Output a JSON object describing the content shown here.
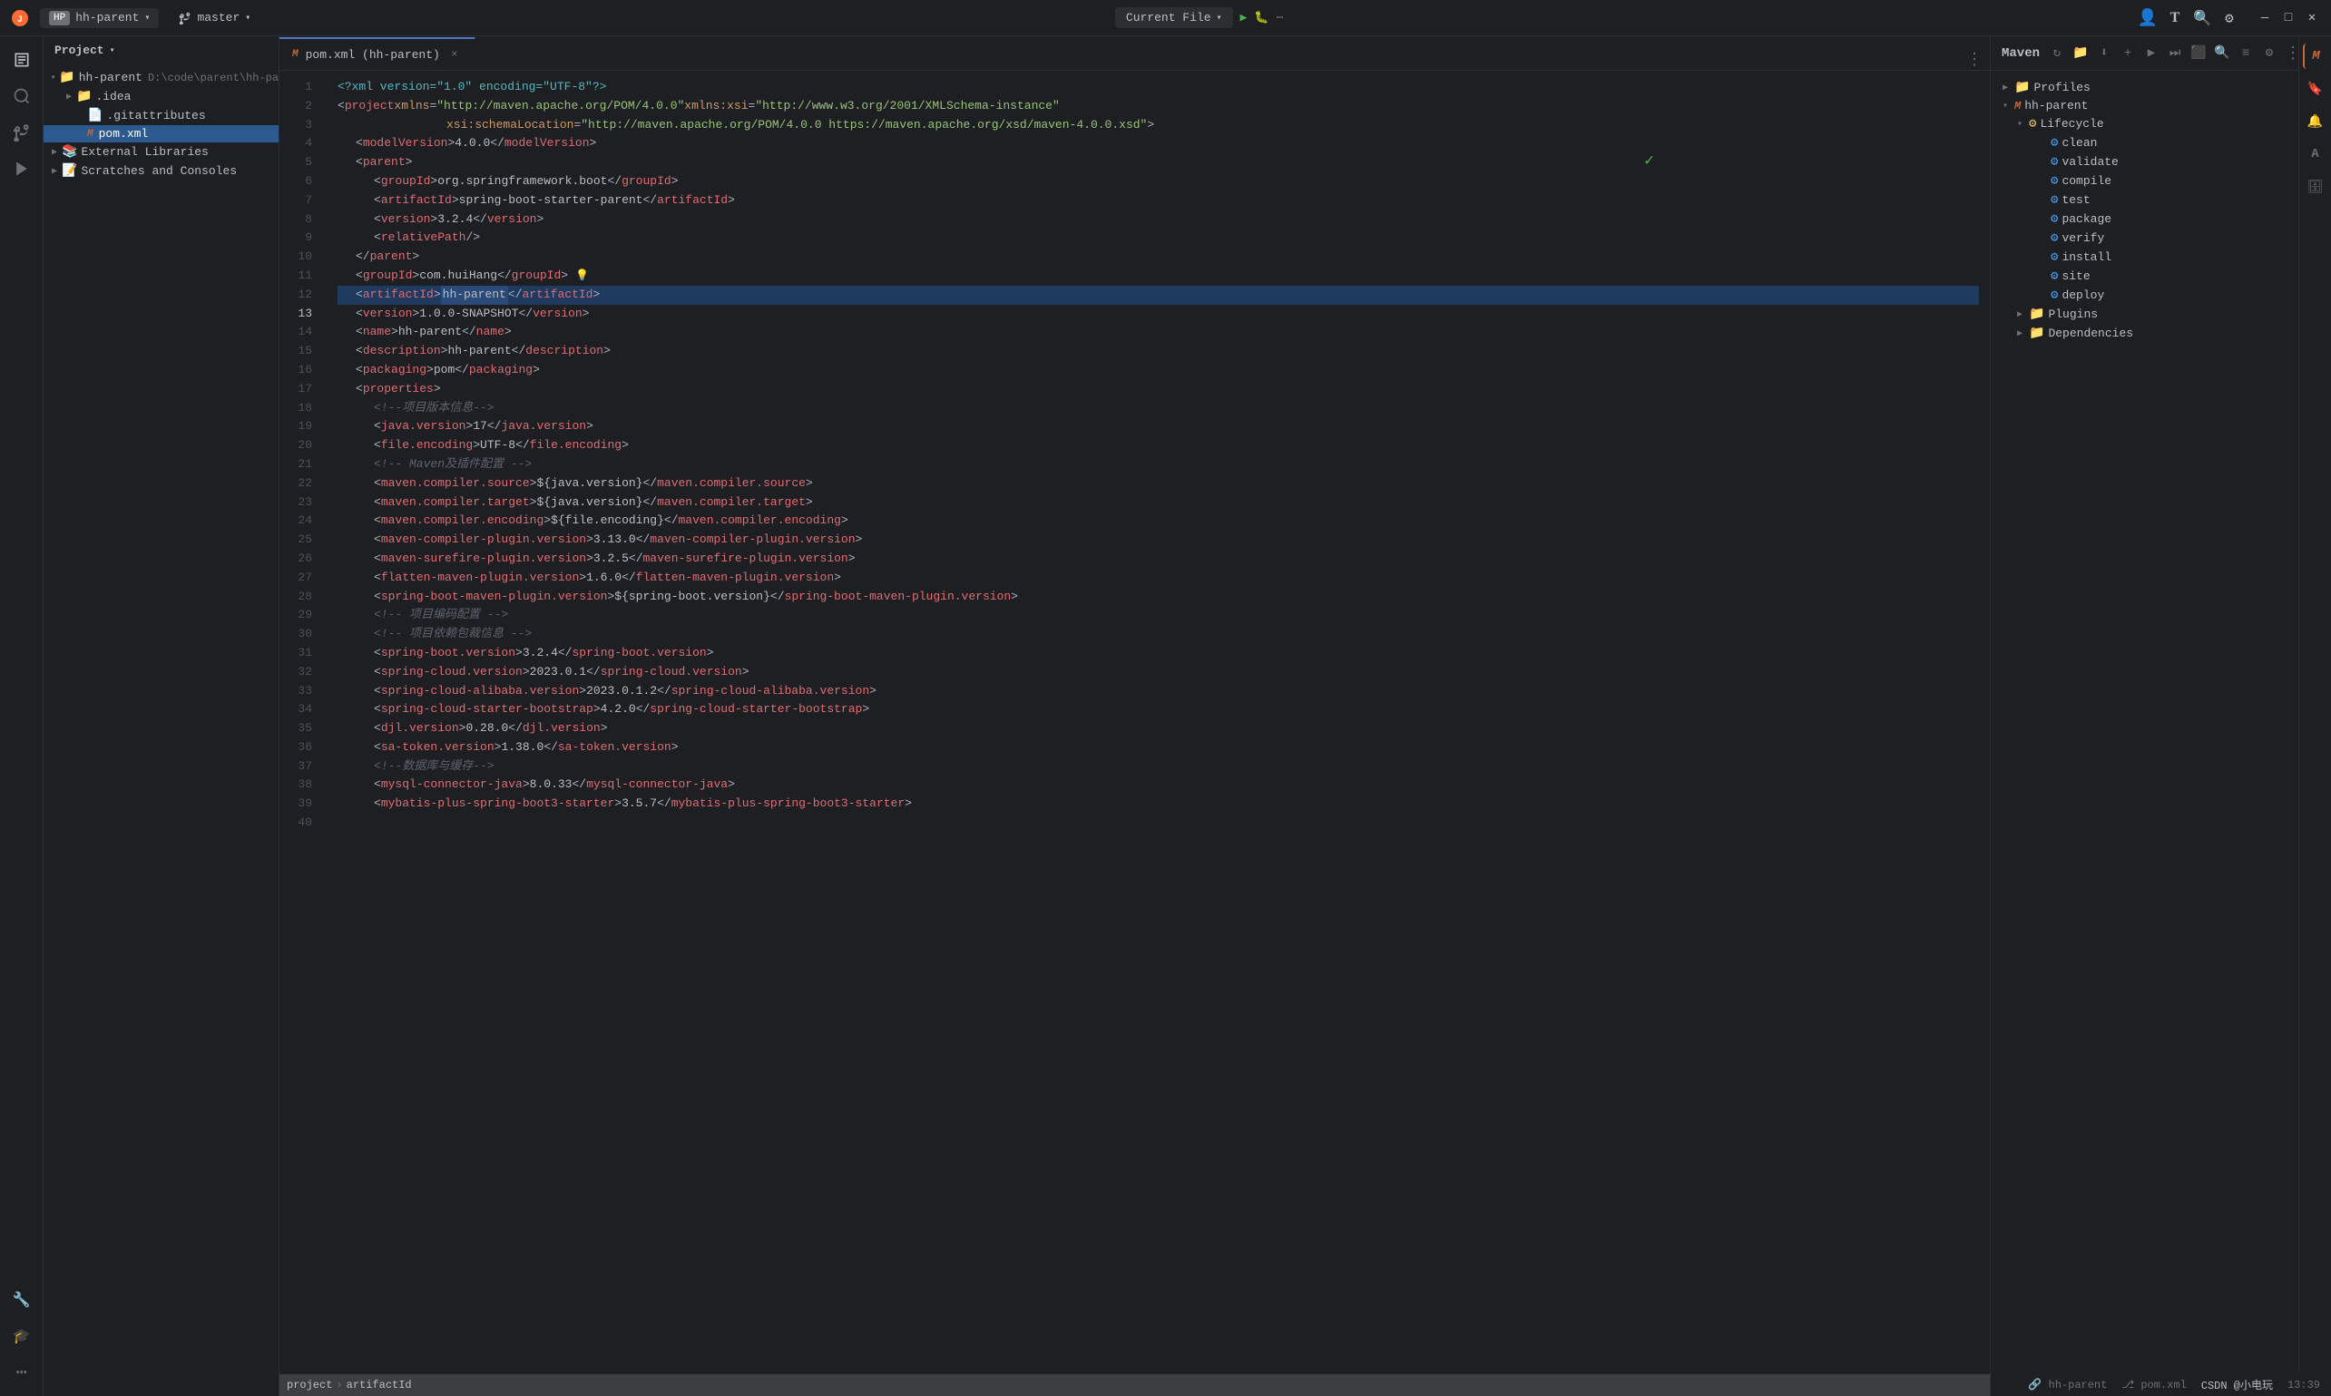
{
  "titleBar": {
    "logo": "🟠",
    "projectLabel": "hh-parent",
    "projectDropdown": "▾",
    "branchIcon": "⎇",
    "branchLabel": "master",
    "branchDropdown": "▾",
    "currentFile": "Current File",
    "currentFileDropdown": "▾",
    "runIcon": "▶",
    "debugIcon": "🐛",
    "moreIcon": "⋯",
    "searchIcon": "🔍",
    "settingsIcon": "⚙",
    "userIcon": "👤",
    "translateIcon": "T",
    "minimizeIcon": "—",
    "maximizeIcon": "□",
    "closeIcon": "✕"
  },
  "activityBar": {
    "icons": [
      {
        "name": "files-icon",
        "symbol": "📁",
        "active": true
      },
      {
        "name": "search-icon",
        "symbol": "🔍",
        "active": false
      },
      {
        "name": "git-icon",
        "symbol": "⎇",
        "active": false
      },
      {
        "name": "run-icon",
        "symbol": "▶",
        "active": false
      },
      {
        "name": "more-icon",
        "symbol": "⋯",
        "active": false
      }
    ]
  },
  "sidebar": {
    "title": "Project",
    "chevron": "▾",
    "tree": [
      {
        "id": 1,
        "level": 0,
        "chevron": "▾",
        "icon": "📁",
        "label": "hh-parent",
        "path": "D:\\code\\parent\\hh-pa",
        "selected": false,
        "type": "folder"
      },
      {
        "id": 2,
        "level": 1,
        "chevron": "▾",
        "icon": "📁",
        "label": ".idea",
        "path": "",
        "selected": false,
        "type": "folder"
      },
      {
        "id": 3,
        "level": 1,
        "chevron": " ",
        "icon": "📄",
        "label": ".gitattributes",
        "path": "",
        "selected": false,
        "type": "file"
      },
      {
        "id": 4,
        "level": 1,
        "chevron": " ",
        "icon": "M",
        "label": "pom.xml",
        "path": "",
        "selected": true,
        "type": "maven"
      },
      {
        "id": 5,
        "level": 0,
        "chevron": "▶",
        "icon": "📚",
        "label": "External Libraries",
        "path": "",
        "selected": false,
        "type": "folder"
      },
      {
        "id": 6,
        "level": 0,
        "chevron": "▶",
        "icon": "📝",
        "label": "Scratches and Consoles",
        "path": "",
        "selected": false,
        "type": "folder"
      }
    ]
  },
  "editor": {
    "tab": {
      "icon": "M",
      "label": "pom.xml (hh-parent)",
      "closeIcon": "×"
    },
    "lines": [
      {
        "num": 1,
        "content": "<?xml version=\"1.0\" encoding=\"UTF-8\"?>",
        "type": "pi"
      },
      {
        "num": 2,
        "content": "<project xmlns=\"http://maven.apache.org/POM/4.0.0\" xmlns:xsi=\"http://www.w3.org/2001/XMLSchema-instance\"",
        "type": "tag"
      },
      {
        "num": 3,
        "content": "         xsi:schemaLocation=\"http://maven.apache.org/POM/4.0.0 https://maven.apache.org/xsd/maven-4.0.0.xsd\">",
        "type": "tag"
      },
      {
        "num": 4,
        "content": "    <modelVersion>4.0.0</modelVersion>",
        "type": "tag"
      },
      {
        "num": 5,
        "content": "    <parent>",
        "type": "tag"
      },
      {
        "num": 6,
        "content": "        <groupId>org.springframework.boot</groupId>",
        "type": "tag"
      },
      {
        "num": 7,
        "content": "        <artifactId>spring-boot-starter-parent</artifactId>",
        "type": "tag"
      },
      {
        "num": 8,
        "content": "        <version>3.2.4</version>",
        "type": "tag"
      },
      {
        "num": 9,
        "content": "        <relativePath/>",
        "type": "tag"
      },
      {
        "num": 10,
        "content": "    </parent>",
        "type": "tag"
      },
      {
        "num": 11,
        "content": "",
        "type": "empty"
      },
      {
        "num": 12,
        "content": "    <groupId>com.huiHang</groupId>",
        "type": "tag",
        "hasHint": true
      },
      {
        "num": 13,
        "content": "    <artifactId>hh-parent</artifactId>",
        "type": "tag",
        "highlighted": true
      },
      {
        "num": 14,
        "content": "    <version>1.0.0-SNAPSHOT</version>",
        "type": "tag"
      },
      {
        "num": 15,
        "content": "    <name>hh-parent</name>",
        "type": "tag"
      },
      {
        "num": 16,
        "content": "    <description>hh-parent</description>",
        "type": "tag"
      },
      {
        "num": 17,
        "content": "    <packaging>pom</packaging>",
        "type": "tag"
      },
      {
        "num": 18,
        "content": "    <properties>",
        "type": "tag"
      },
      {
        "num": 19,
        "content": "        <!--项目版本信息-->",
        "type": "comment"
      },
      {
        "num": 20,
        "content": "        <java.version>17</java.version>",
        "type": "tag"
      },
      {
        "num": 21,
        "content": "        <file.encoding>UTF-8</file.encoding>",
        "type": "tag"
      },
      {
        "num": 22,
        "content": "        <!-- Maven及插件配置 -->",
        "type": "comment"
      },
      {
        "num": 23,
        "content": "        <maven.compiler.source>${java.version}</maven.compiler.source>",
        "type": "tag"
      },
      {
        "num": 24,
        "content": "        <maven.compiler.target>${java.version}</maven.compiler.target>",
        "type": "tag"
      },
      {
        "num": 25,
        "content": "        <maven.compiler.encoding>${file.encoding}</maven.compiler.encoding>",
        "type": "tag"
      },
      {
        "num": 26,
        "content": "        <maven-compiler-plugin.version>3.13.0</maven-compiler-plugin.version>",
        "type": "tag"
      },
      {
        "num": 27,
        "content": "        <maven-surefire-plugin.version>3.2.5</maven-surefire-plugin.version>",
        "type": "tag"
      },
      {
        "num": 28,
        "content": "        <flatten-maven-plugin.version>1.6.0</flatten-maven-plugin.version>",
        "type": "tag"
      },
      {
        "num": 29,
        "content": "        <spring-boot-maven-plugin.version>${spring-boot.version}</spring-boot-maven-plugin.version>",
        "type": "tag"
      },
      {
        "num": 30,
        "content": "        <!-- 项目编码配置 -->",
        "type": "comment"
      },
      {
        "num": 31,
        "content": "        <!-- 项目依赖包裁信息 -->",
        "type": "comment"
      },
      {
        "num": 32,
        "content": "        <spring-boot.version>3.2.4</spring-boot.version>",
        "type": "tag"
      },
      {
        "num": 33,
        "content": "        <spring-cloud.version>2023.0.1</spring-cloud.version>",
        "type": "tag"
      },
      {
        "num": 34,
        "content": "        <spring-cloud-alibaba.version>2023.0.1.2</spring-cloud-alibaba.version>",
        "type": "tag"
      },
      {
        "num": 35,
        "content": "        <spring-cloud-starter-bootstrap>4.2.0</spring-cloud-starter-bootstrap>",
        "type": "tag"
      },
      {
        "num": 36,
        "content": "        <djl.version>0.28.0</djl.version>",
        "type": "tag"
      },
      {
        "num": 37,
        "content": "        <sa-token.version>1.38.0</sa-token.version>",
        "type": "tag"
      },
      {
        "num": 38,
        "content": "        <!--数据库与缓存-->",
        "type": "comment"
      },
      {
        "num": 39,
        "content": "        <mysql-connector-java>8.0.33</mysql-connector-java>",
        "type": "tag"
      },
      {
        "num": 40,
        "content": "        <mybatis-plus-spring-boot3-starter>3.5.7</mybatis-plus-spring-boot3-starter>",
        "type": "tag"
      }
    ]
  },
  "maven": {
    "title": "Maven",
    "profiles": {
      "label": "Profiles",
      "expanded": false
    },
    "project": {
      "label": "hh-parent",
      "expanded": true,
      "lifecycle": {
        "label": "Lifecycle",
        "expanded": true,
        "phases": [
          "clean",
          "validate",
          "compile",
          "test",
          "package",
          "verify",
          "install",
          "site",
          "deploy"
        ]
      },
      "plugins": {
        "label": "Plugins",
        "expanded": false
      },
      "dependencies": {
        "label": "Dependencies",
        "expanded": false
      }
    }
  },
  "statusBar": {
    "breadcrumb": [
      "project",
      "artifactId"
    ],
    "rightItems": [
      "hh-parent",
      "pom.xml",
      "13:39"
    ]
  },
  "rightPanel": {
    "icons": [
      {
        "name": "maven-icon",
        "symbol": "M",
        "active": true,
        "maven": true
      },
      {
        "name": "bookmark-icon",
        "symbol": "🔖",
        "active": false
      },
      {
        "name": "notification-icon",
        "symbol": "🔔",
        "active": false
      },
      {
        "name": "translate-icon",
        "symbol": "A",
        "active": false
      },
      {
        "name": "database-icon",
        "symbol": "🗄",
        "active": false
      }
    ]
  },
  "watermark": {
    "text": "CSDN @小电玩",
    "time": "13:39"
  }
}
